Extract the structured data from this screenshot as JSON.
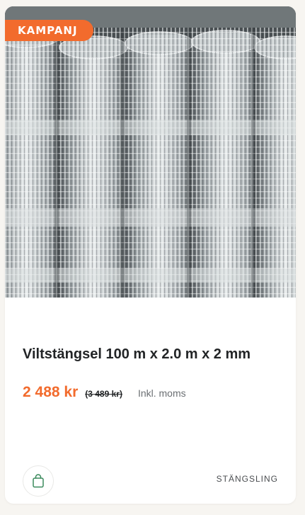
{
  "product": {
    "badge": "KAMPANJ",
    "title": "Viltstängsel 100 m x 2.0 m x 2 mm",
    "price_current": "2 488 kr",
    "price_old": "(3 489 kr)",
    "price_vat_note": "Inkl. moms",
    "category": "STÄNGSLING",
    "image_alt": "Rolls of galvanized wire fence"
  },
  "icons": {
    "cart": "shopping-bag-icon"
  },
  "colors": {
    "accent": "#f26b2d",
    "cart_icon": "#3a8a5c",
    "title": "#222426",
    "background": "#f7f5f1"
  }
}
